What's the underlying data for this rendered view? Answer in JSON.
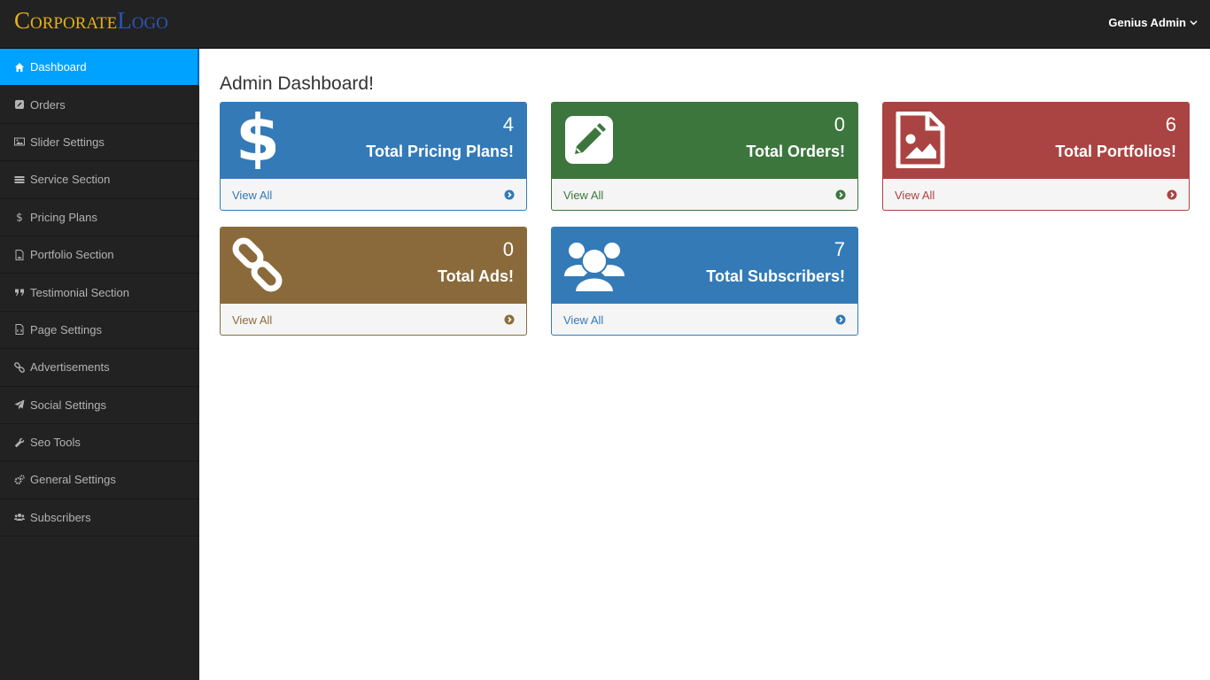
{
  "header": {
    "logo_part1": "Corporate",
    "logo_part2": "Logo",
    "user_name": "Genius Admin"
  },
  "sidebar": {
    "items": [
      {
        "label": "Dashboard",
        "icon": "home-icon",
        "active": true
      },
      {
        "label": "Orders",
        "icon": "edit-icon"
      },
      {
        "label": "Slider Settings",
        "icon": "image-icon"
      },
      {
        "label": "Service Section",
        "icon": "tasks-icon"
      },
      {
        "label": "Pricing Plans",
        "icon": "dollar-icon"
      },
      {
        "label": "Portfolio Section",
        "icon": "file-image-icon"
      },
      {
        "label": "Testimonial Section",
        "icon": "quote-icon"
      },
      {
        "label": "Page Settings",
        "icon": "file-code-icon"
      },
      {
        "label": "Advertisements",
        "icon": "link-icon"
      },
      {
        "label": "Social Settings",
        "icon": "paper-plane-icon"
      },
      {
        "label": "Seo Tools",
        "icon": "wrench-icon"
      },
      {
        "label": "General Settings",
        "icon": "cogs-icon"
      },
      {
        "label": "Subscribers",
        "icon": "users-icon"
      }
    ]
  },
  "main": {
    "title": "Admin Dashboard!",
    "panels": [
      {
        "count": "4",
        "label": "Total Pricing Plans!",
        "link": "View All",
        "icon": "dollar-icon",
        "color": "#337ab7"
      },
      {
        "count": "0",
        "label": "Total Orders!",
        "link": "View All",
        "icon": "edit-icon",
        "color": "#3c763d"
      },
      {
        "count": "6",
        "label": "Total Portfolios!",
        "link": "View All",
        "icon": "file-image-icon",
        "color": "#a94442"
      },
      {
        "count": "0",
        "label": "Total Ads!",
        "link": "View All",
        "icon": "link-icon",
        "color": "#8a6a3a"
      },
      {
        "count": "7",
        "label": "Total Subscribers!",
        "link": "View All",
        "icon": "users-icon",
        "color": "#337ab7"
      }
    ]
  },
  "colors": {
    "topbar": "#222222",
    "sidebar": "#222222",
    "active_nav": "#00a2ff",
    "logo_gold": "#e6b116",
    "logo_blue": "#2a55b8"
  }
}
